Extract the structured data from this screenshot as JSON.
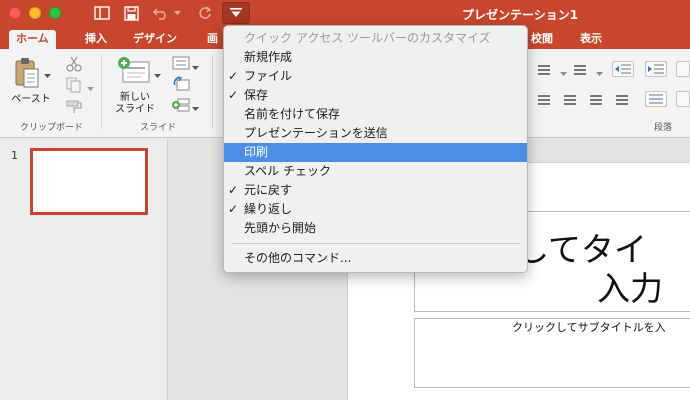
{
  "window": {
    "title": "プレゼンテーション1"
  },
  "tabs": [
    {
      "label": "ホーム"
    },
    {
      "label": "挿入"
    },
    {
      "label": "デザイン"
    },
    {
      "label": "画面"
    },
    {
      "label": "校閲"
    },
    {
      "label": "表示"
    }
  ],
  "ribbon": {
    "paste_label": "ペースト",
    "new_slide_label_line1": "新しい",
    "new_slide_label_line2": "スライド",
    "group_clipboard": "クリップボード",
    "group_slides": "スライド",
    "group_paragraph": "段落"
  },
  "thumbnails": [
    {
      "number": "1"
    }
  ],
  "slide": {
    "title_line1": "クしてタイ",
    "title_line2": "入力",
    "subtitle_placeholder": "クリックしてサブタイトルを入"
  },
  "quick_access_menu": {
    "header": "クイック アクセス ツールバーのカスタマイズ",
    "items": [
      {
        "label": "新規作成",
        "checked": false
      },
      {
        "label": "ファイル",
        "checked": true
      },
      {
        "label": "保存",
        "checked": true
      },
      {
        "label": "名前を付けて保存",
        "checked": false
      },
      {
        "label": "プレゼンテーションを送信",
        "checked": false
      },
      {
        "label": "印刷",
        "checked": false,
        "highlighted": true
      },
      {
        "label": "スペル チェック",
        "checked": false
      },
      {
        "label": "元に戻す",
        "checked": true
      },
      {
        "label": "繰り返し",
        "checked": true
      },
      {
        "label": "先頭から開始",
        "checked": false
      }
    ],
    "more_commands": "その他のコマンド...",
    "check_glyph": "✓"
  },
  "colors": {
    "accent": "#c8462b",
    "highlight": "#4a8ee8"
  }
}
